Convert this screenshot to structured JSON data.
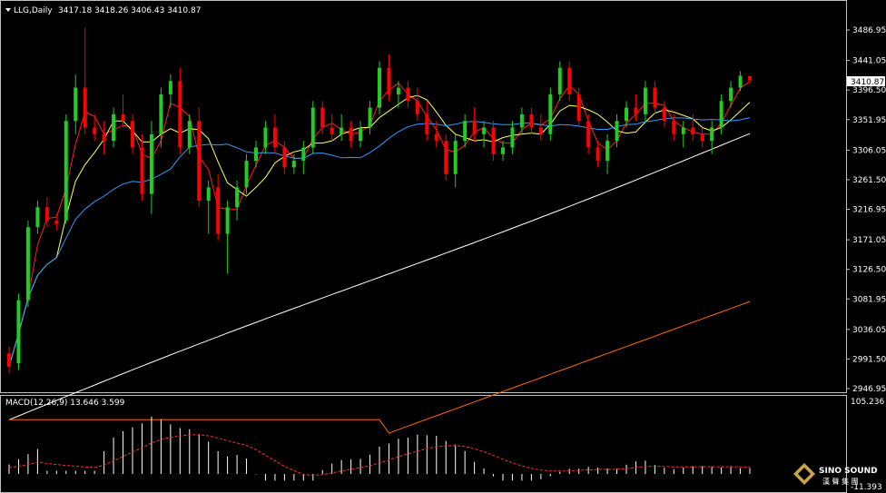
{
  "main": {
    "title": "LLG,Daily",
    "ohlc": "3417.18 3418.26 3406.43 3410.87",
    "current_price_label": "3410.87"
  },
  "macd": {
    "label": "MACD(12,26,9) 13.646 3.599",
    "axis_top": "105.236",
    "axis_bottom": "-11.393"
  },
  "logo": {
    "name": "SINO SOUND",
    "subtitle": "漢 聲 集 團"
  },
  "colors": {
    "up": "#22cc22",
    "down": "#ff0000",
    "ma_fast": "#ff2020",
    "ma_mid": "#ffff66",
    "ma_slow": "#3399ff",
    "ma_long": "#ffffff",
    "ma_longest": "#ff6600",
    "grid": "#c0c0c0"
  },
  "chart_data": {
    "type": "candlestick",
    "y_ticks": [
      "3486.95",
      "3441.05",
      "3396.50",
      "3351.95",
      "3306.05",
      "3261.50",
      "3216.95",
      "3171.05",
      "3126.50",
      "3081.95",
      "3036.05",
      "2991.50",
      "2946.95"
    ],
    "ylim": [
      2946.95,
      3486.95
    ],
    "candles": [
      [
        3000,
        3010,
        2970,
        2980
      ],
      [
        2985,
        3090,
        2975,
        3080
      ],
      [
        3080,
        3200,
        3070,
        3190
      ],
      [
        3190,
        3230,
        3180,
        3220
      ],
      [
        3220,
        3235,
        3190,
        3200
      ],
      [
        3200,
        3210,
        3185,
        3195
      ],
      [
        3200,
        3360,
        3195,
        3350
      ],
      [
        3350,
        3420,
        3330,
        3400
      ],
      [
        3400,
        3490,
        3330,
        3340
      ],
      [
        3340,
        3360,
        3320,
        3330
      ],
      [
        3330,
        3350,
        3300,
        3320
      ],
      [
        3320,
        3370,
        3310,
        3360
      ],
      [
        3360,
        3390,
        3340,
        3350
      ],
      [
        3350,
        3360,
        3300,
        3310
      ],
      [
        3310,
        3330,
        3230,
        3240
      ],
      [
        3240,
        3350,
        3210,
        3330
      ],
      [
        3330,
        3400,
        3310,
        3390
      ],
      [
        3390,
        3420,
        3370,
        3410
      ],
      [
        3410,
        3430,
        3300,
        3310
      ],
      [
        3310,
        3360,
        3300,
        3350
      ],
      [
        3350,
        3370,
        3220,
        3230
      ],
      [
        3230,
        3260,
        3180,
        3250
      ],
      [
        3250,
        3270,
        3170,
        3180
      ],
      [
        3180,
        3230,
        3120,
        3220
      ],
      [
        3220,
        3260,
        3200,
        3250
      ],
      [
        3250,
        3300,
        3240,
        3290
      ],
      [
        3290,
        3320,
        3280,
        3310
      ],
      [
        3310,
        3350,
        3300,
        3340
      ],
      [
        3340,
        3360,
        3300,
        3310
      ],
      [
        3310,
        3320,
        3270,
        3280
      ],
      [
        3280,
        3300,
        3270,
        3290
      ],
      [
        3290,
        3320,
        3270,
        3310
      ],
      [
        3310,
        3380,
        3300,
        3370
      ],
      [
        3370,
        3380,
        3330,
        3340
      ],
      [
        3340,
        3360,
        3320,
        3330
      ],
      [
        3330,
        3360,
        3320,
        3340
      ],
      [
        3340,
        3350,
        3310,
        3320
      ],
      [
        3320,
        3350,
        3310,
        3340
      ],
      [
        3340,
        3380,
        3330,
        3370
      ],
      [
        3370,
        3440,
        3360,
        3430
      ],
      [
        3430,
        3450,
        3380,
        3390
      ],
      [
        3390,
        3410,
        3370,
        3400
      ],
      [
        3400,
        3410,
        3370,
        3380
      ],
      [
        3380,
        3400,
        3350,
        3360
      ],
      [
        3360,
        3380,
        3320,
        3330
      ],
      [
        3330,
        3350,
        3310,
        3320
      ],
      [
        3320,
        3330,
        3260,
        3270
      ],
      [
        3270,
        3330,
        3250,
        3320
      ],
      [
        3320,
        3360,
        3310,
        3350
      ],
      [
        3350,
        3370,
        3320,
        3330
      ],
      [
        3330,
        3350,
        3310,
        3340
      ],
      [
        3340,
        3350,
        3290,
        3300
      ],
      [
        3300,
        3320,
        3290,
        3310
      ],
      [
        3310,
        3350,
        3300,
        3340
      ],
      [
        3340,
        3370,
        3330,
        3360
      ],
      [
        3360,
        3370,
        3330,
        3340
      ],
      [
        3340,
        3360,
        3320,
        3330
      ],
      [
        3330,
        3400,
        3320,
        3390
      ],
      [
        3390,
        3440,
        3380,
        3430
      ],
      [
        3430,
        3440,
        3380,
        3390
      ],
      [
        3390,
        3400,
        3340,
        3350
      ],
      [
        3350,
        3360,
        3300,
        3310
      ],
      [
        3310,
        3320,
        3280,
        3290
      ],
      [
        3290,
        3330,
        3270,
        3320
      ],
      [
        3320,
        3360,
        3310,
        3350
      ],
      [
        3350,
        3380,
        3340,
        3370
      ],
      [
        3370,
        3390,
        3350,
        3360
      ],
      [
        3360,
        3410,
        3350,
        3400
      ],
      [
        3400,
        3410,
        3360,
        3370
      ],
      [
        3370,
        3380,
        3340,
        3350
      ],
      [
        3350,
        3360,
        3320,
        3330
      ],
      [
        3330,
        3350,
        3310,
        3340
      ],
      [
        3340,
        3360,
        3320,
        3330
      ],
      [
        3330,
        3340,
        3310,
        3320
      ],
      [
        3320,
        3350,
        3300,
        3340
      ],
      [
        3340,
        3390,
        3330,
        3380
      ],
      [
        3380,
        3410,
        3370,
        3400
      ],
      [
        3400,
        3425,
        3395,
        3418
      ],
      [
        3417.18,
        3418.26,
        3406.43,
        3410.87
      ]
    ],
    "macd_histogram": [],
    "macd_signal": []
  }
}
